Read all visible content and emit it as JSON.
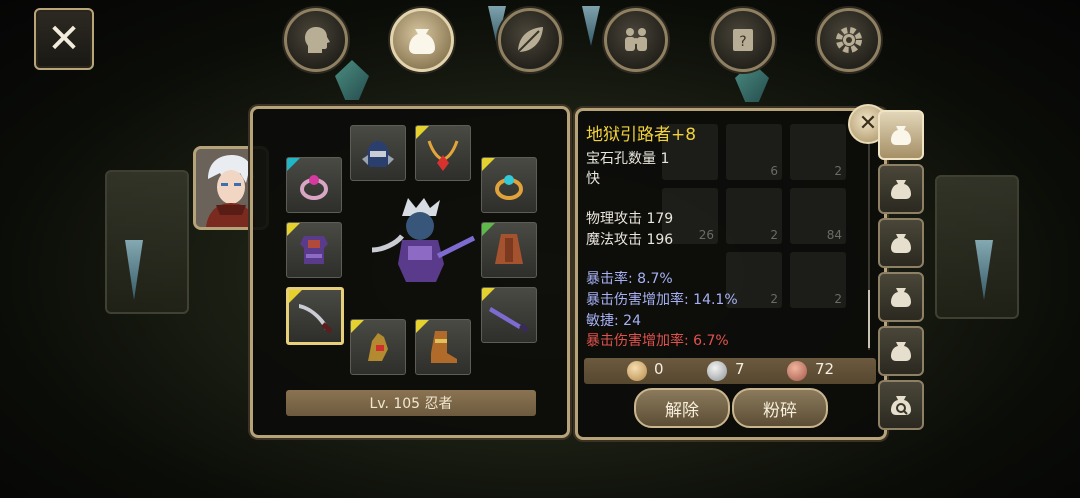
{
  "window": {
    "close_label": "✕"
  },
  "tabs": [
    {
      "name": "character",
      "icon": "head-icon",
      "active": false
    },
    {
      "name": "inventory",
      "icon": "bag-icon",
      "active": true
    },
    {
      "name": "skills",
      "icon": "leaf-icon",
      "active": false
    },
    {
      "name": "party",
      "icon": "people-icon",
      "active": false
    },
    {
      "name": "quests",
      "icon": "scroll-icon",
      "active": false
    },
    {
      "name": "settings",
      "icon": "gear-icon",
      "active": false
    }
  ],
  "character": {
    "level_label": "Lv. 105 忍者"
  },
  "item": {
    "name": "地狱引路者+8",
    "gem_slots": "宝石孔数量 1",
    "speed": "快",
    "physical_attack": "物理攻击 179",
    "magic_attack": "魔法攻击 196",
    "crit_rate": "暴击率: 8.7%",
    "crit_damage_bonus": "暴击伤害增加率: 14.1%",
    "agility": "敏捷: 24",
    "crit_damage_bonus_red": "暴击伤害增加率: 6.7%"
  },
  "currency": {
    "gold": "0",
    "silver": "7",
    "copper": "72"
  },
  "buttons": {
    "unequip": "解除",
    "shatter": "粉碎"
  },
  "inventory_counts": [
    "6",
    "2",
    "26",
    "2",
    "84",
    "2",
    "2"
  ],
  "colors": {
    "item_name": "#f2d23b",
    "stat_blue": "#a7b0f3",
    "stat_red": "#e0524e",
    "panel_border": "#b7a37a"
  }
}
